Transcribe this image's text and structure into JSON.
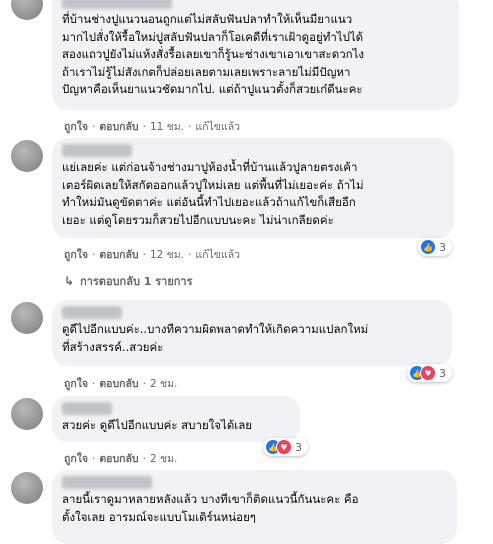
{
  "actions": {
    "like": "ถูกใจ",
    "reply": "ตอบกลับ",
    "edited": "แก้ไขแล้ว",
    "dot": "·"
  },
  "comments": [
    {
      "text": "ที่บ้านช่างปูแนวนอนถูกแต่ไม่สลับฟันปลาทำให้เห็นมียาแนว\nมากไปสั่งให้รื้อใหม่ปูสลับฟันปลาก็โอเคดีที่เราเฝ้าดูอยู่ทำไปได้\nสองแถวปูยังไม่แห้งสั่งรื้อเลยเขาก็รู้นะช่างเขาเอาเขาสะดวกไง\nถ้าเราไม่รู้ไม่สังเกตก็ปล่อยเลยตามเลยเพราะลายไม่มีปัญหา\nปัญหาคือเห็นยาแนวชัดมากไป. แต่ถ้าปูแนวตั้งก็สวยเก๋ดีนะคะ",
      "time": "11 ชม.",
      "edited": true
    },
    {
      "text": "แย่เลยค่ะ แต่ก่อนจ้างช่างมาปูห้องน้ำที่บ้านแล้วปูลายตรงเค้า\nเตอร์ผิดเลยให้สกัดออกแล้วปูใหม่เลย แต่พื้นที่ไม่เยอะค่ะ ถ้าไม่\nทำใหม่มันดูขัดตาค่ะ แต่อันนี้ทำไปเยอะแล้วถ้าแก้ไขก็เสียอีก\nเยอะ แต่ดูโดยรวมก็สวยไปอีกแบบนะคะ ไม่น่าเกลียดค่ะ",
      "time": "12 ชม.",
      "edited": true,
      "reactions": "3"
    },
    {
      "text": "ดูดีไปอีกแบบค่ะ..บางทีความผิดพลาดทำให้เกิดความแปลกใหม่\nที่สร้างสรรค์..สวยค่ะ",
      "time": "2 ชม.",
      "reactions": "3"
    },
    {
      "text": "สวยค่ะ ดูดีไปอีกแบบค่ะ สบายใจได้เลย",
      "time": "2 ชม.",
      "reactions": "3"
    },
    {
      "text": "ลายนี้เราดูมาหลายหลังแล้ว บางทีเขาก็ติดแนวนี้กันนะคะ คือ\nตั้งใจเลย อารมณ์จะแบบโมเดิร์นหน่อยๆ"
    }
  ],
  "replies_link": "การตอบกลับ 1 รายการ"
}
